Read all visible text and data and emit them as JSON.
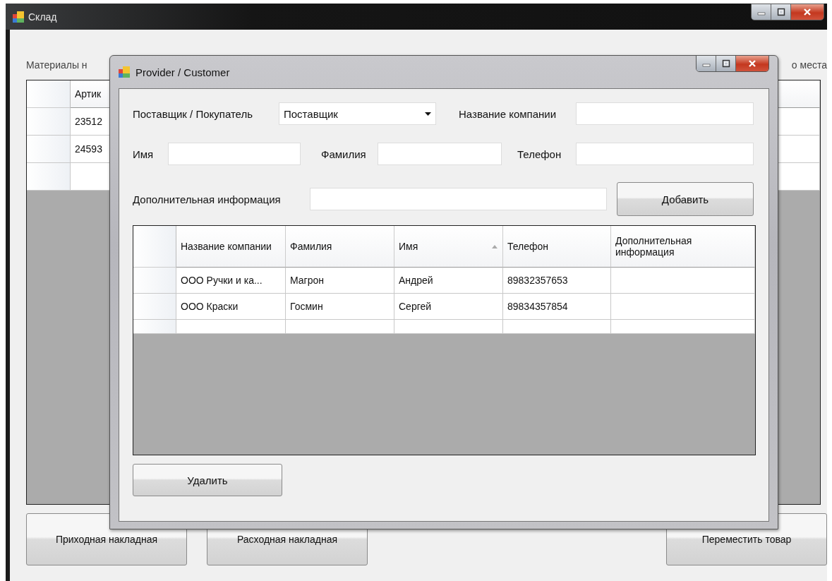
{
  "main_window": {
    "title": "Склад",
    "labels": [
      "Материалы н",
      "о места"
    ],
    "table": {
      "columns": [
        "Артик"
      ],
      "rows": [
        [
          "23512"
        ],
        [
          "24593"
        ]
      ],
      "new_row": true
    },
    "buttons": [
      "Приходная накладная",
      "Расходная накладная",
      "Переместить товар"
    ]
  },
  "dialog": {
    "title": "Provider / Customer",
    "form_rows": [
      [
        {
          "label": "Поставщик / Покупатель",
          "kind": "select",
          "value": "Поставщик"
        },
        {
          "label": "Название компании",
          "kind": "text"
        }
      ],
      [
        {
          "label": "Имя",
          "kind": "text"
        },
        {
          "label": "Фамилия",
          "kind": "text"
        },
        {
          "label": "Телефон",
          "kind": "text"
        }
      ],
      [
        {
          "label": "Дополнительная информация",
          "kind": "text"
        }
      ]
    ],
    "add_button": "Добавить",
    "table": {
      "columns": [
        {
          "label": "Название компании",
          "sorted": false
        },
        {
          "label": "Фамилия",
          "sorted": false
        },
        {
          "label": "Имя",
          "sorted": true
        },
        {
          "label": "Телефон",
          "sorted": false
        },
        {
          "label": "Дополнительная информация",
          "sorted": false
        }
      ],
      "rows": [
        [
          "ООО Ручки и ка...",
          "Магрон",
          "Андрей",
          "89832357653",
          ""
        ],
        [
          "ООО Краски",
          "Госмин",
          "Сергей",
          "89834357854",
          ""
        ]
      ],
      "new_row": true
    },
    "delete_button": "Удалить"
  }
}
